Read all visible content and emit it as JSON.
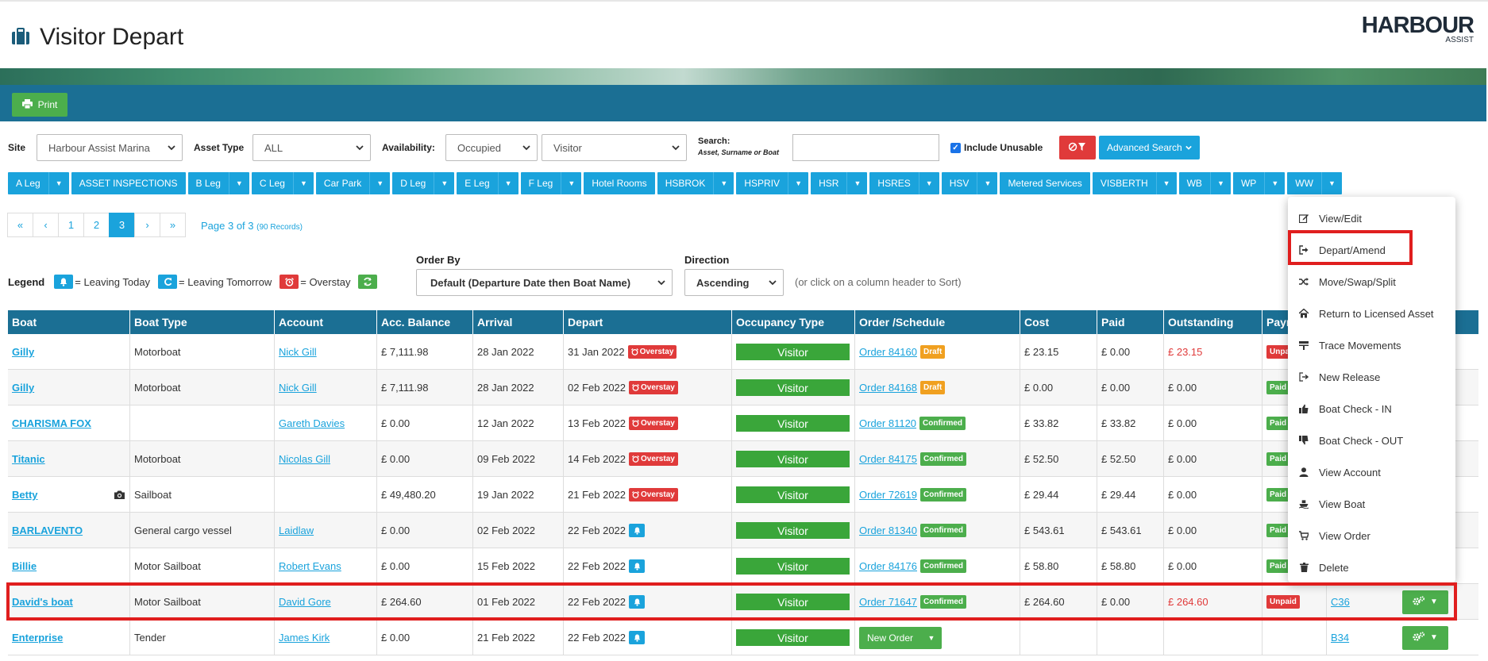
{
  "page": {
    "title": "Visitor Depart",
    "logo_main": "HARBOUR",
    "logo_sub": "ASSIST"
  },
  "toolbar": {
    "print_label": "Print"
  },
  "filters": {
    "site_label": "Site",
    "site_value": "Harbour Assist Marina",
    "asset_type_label": "Asset Type",
    "asset_type_value": "ALL",
    "availability_label": "Availability:",
    "availability_value": "Occupied",
    "availability_value2": "Visitor",
    "search_label": "Search:",
    "search_sub": "Asset, Surname or Boat",
    "search_value": "",
    "include_unusable_label": "Include Unusable",
    "include_unusable_checked": true,
    "advanced_search_label": "Advanced Search"
  },
  "leg_tabs": [
    {
      "label": "A Leg",
      "dropdown": true
    },
    {
      "label": "ASSET INSPECTIONS",
      "dropdown": false
    },
    {
      "label": "B Leg",
      "dropdown": true
    },
    {
      "label": "C Leg",
      "dropdown": true
    },
    {
      "label": "Car Park",
      "dropdown": true
    },
    {
      "label": "D Leg",
      "dropdown": true
    },
    {
      "label": "E Leg",
      "dropdown": true
    },
    {
      "label": "F Leg",
      "dropdown": true
    },
    {
      "label": "Hotel Rooms",
      "dropdown": false
    },
    {
      "label": "HSBROK",
      "dropdown": true
    },
    {
      "label": "HSPRIV",
      "dropdown": true
    },
    {
      "label": "HSR",
      "dropdown": true
    },
    {
      "label": "HSRES",
      "dropdown": true
    },
    {
      "label": "HSV",
      "dropdown": true
    },
    {
      "label": "Metered Services",
      "dropdown": false
    },
    {
      "label": "VISBERTH",
      "dropdown": true
    },
    {
      "label": "WB",
      "dropdown": true
    },
    {
      "label": "WP",
      "dropdown": true
    },
    {
      "label": "WW",
      "dropdown": true
    }
  ],
  "pagination": {
    "buttons": [
      "«",
      "‹",
      "1",
      "2",
      "3",
      "›",
      "»"
    ],
    "active": "3",
    "info": "Page 3 of 3",
    "records": "(90 Records)"
  },
  "legend": {
    "title": "Legend",
    "leaving_today": "= Leaving Today",
    "leaving_tomorrow": "= Leaving Tomorrow",
    "overstay": "= Overstay"
  },
  "order": {
    "order_by_label": "Order By",
    "order_by_value": "Default (Departure Date then Boat Name)",
    "direction_label": "Direction",
    "direction_value": "Ascending",
    "hint": "(or click on a column header to Sort)"
  },
  "table": {
    "columns": [
      "Boat",
      "Boat Type",
      "Account",
      "Acc. Balance",
      "Arrival",
      "Depart",
      "Occupancy Type",
      "Order /Schedule",
      "Cost",
      "Paid",
      "Outstanding",
      "Paym"
    ],
    "rows": [
      {
        "boat": "Gilly",
        "type": "Motorboat",
        "account": "Nick Gill",
        "balance": "£ 7,111.98",
        "arrival": "28 Jan 2022",
        "depart": "31 Jan 2022",
        "flag": "Overstay",
        "occupancy": "Visitor",
        "order": "Order 84160",
        "order_status": "Draft",
        "cost": "£ 23.15",
        "paid": "£ 0.00",
        "outstanding": "£ 23.15",
        "outstanding_red": true,
        "payment": "Unpaid",
        "asset": ""
      },
      {
        "boat": "Gilly",
        "type": "Motorboat",
        "account": "Nick Gill",
        "balance": "£ 7,111.98",
        "arrival": "28 Jan 2022",
        "depart": "02 Feb 2022",
        "flag": "Overstay",
        "occupancy": "Visitor",
        "order": "Order 84168",
        "order_status": "Draft",
        "cost": "£ 0.00",
        "paid": "£ 0.00",
        "outstanding": "£ 0.00",
        "outstanding_red": false,
        "payment": "Paid",
        "asset": ""
      },
      {
        "boat": "CHARISMA FOX",
        "type": "",
        "account": "Gareth Davies",
        "balance": "£ 0.00",
        "arrival": "12 Jan 2022",
        "depart": "13 Feb 2022",
        "flag": "Overstay",
        "occupancy": "Visitor",
        "order": "Order 81120",
        "order_status": "Confirmed",
        "cost": "£ 33.82",
        "paid": "£ 33.82",
        "outstanding": "£ 0.00",
        "outstanding_red": false,
        "payment": "Paid",
        "asset": ""
      },
      {
        "boat": "Titanic",
        "type": "Motorboat",
        "account": "Nicolas Gill",
        "balance": "£ 0.00",
        "arrival": "09 Feb 2022",
        "depart": "14 Feb 2022",
        "flag": "Overstay",
        "occupancy": "Visitor",
        "order": "Order 84175",
        "order_status": "Confirmed",
        "cost": "£ 52.50",
        "paid": "£ 52.50",
        "outstanding": "£ 0.00",
        "outstanding_red": false,
        "payment": "Paid",
        "asset": ""
      },
      {
        "boat": "Betty",
        "type": "Sailboat",
        "account": "",
        "balance": "£ 49,480.20",
        "arrival": "19 Jan 2022",
        "depart": "21 Feb 2022",
        "flag": "Overstay",
        "occupancy": "Visitor",
        "order": "Order 72619",
        "order_status": "Confirmed",
        "cost": "£ 29.44",
        "paid": "£ 29.44",
        "outstanding": "£ 0.00",
        "outstanding_red": false,
        "payment": "Paid",
        "asset": "",
        "camera": true
      },
      {
        "boat": "BARLAVENTO",
        "type": "General cargo vessel",
        "account": "Laidlaw",
        "balance": "£ 0.00",
        "arrival": "02 Feb 2022",
        "depart": "22 Feb 2022",
        "flag": "bell",
        "occupancy": "Visitor",
        "order": "Order 81340",
        "order_status": "Confirmed",
        "cost": "£ 543.61",
        "paid": "£ 543.61",
        "outstanding": "£ 0.00",
        "outstanding_red": false,
        "payment": "Paid",
        "asset": ""
      },
      {
        "boat": "Billie",
        "type": "Motor Sailboat",
        "account": "Robert Evans",
        "balance": "£ 0.00",
        "arrival": "15 Feb 2022",
        "depart": "22 Feb 2022",
        "flag": "bell",
        "occupancy": "Visitor",
        "order": "Order 84176",
        "order_status": "Confirmed",
        "cost": "£ 58.80",
        "paid": "£ 58.80",
        "outstanding": "£ 0.00",
        "outstanding_red": false,
        "payment": "Paid",
        "asset": ""
      },
      {
        "boat": "David's boat",
        "type": "Motor Sailboat",
        "account": "David Gore",
        "balance": "£ 264.60",
        "arrival": "01 Feb 2022",
        "depart": "22 Feb 2022",
        "flag": "bell",
        "occupancy": "Visitor",
        "order": "Order 71647",
        "order_status": "Confirmed",
        "cost": "£ 264.60",
        "paid": "£ 0.00",
        "outstanding": "£ 264.60",
        "outstanding_red": true,
        "payment": "Unpaid",
        "asset": "C36",
        "gear": true
      },
      {
        "boat": "Enterprise",
        "type": "Tender",
        "account": "James Kirk",
        "balance": "£ 0.00",
        "arrival": "21 Feb 2022",
        "depart": "22 Feb 2022",
        "flag": "bell",
        "occupancy": "Visitor",
        "order": "",
        "new_order": "New Order",
        "order_status": "",
        "cost": "",
        "paid": "",
        "outstanding": "",
        "outstanding_red": false,
        "payment": "",
        "asset": "B34",
        "gear": true
      }
    ]
  },
  "action_menu": {
    "items": [
      {
        "label": "View/Edit",
        "icon": "edit-icon"
      },
      {
        "label": "Depart/Amend",
        "icon": "sign-out-icon"
      },
      {
        "label": "Move/Swap/Split",
        "icon": "shuffle-icon"
      },
      {
        "label": "Return to Licensed Asset",
        "icon": "home-icon"
      },
      {
        "label": "Trace Movements",
        "icon": "trace-icon"
      },
      {
        "label": "New Release",
        "icon": "release-icon"
      },
      {
        "label": "Boat Check - IN",
        "icon": "thumbs-up-icon"
      },
      {
        "label": "Boat Check - OUT",
        "icon": "thumbs-down-icon"
      },
      {
        "label": "View Account",
        "icon": "user-icon"
      },
      {
        "label": "View Boat",
        "icon": "boat-icon"
      },
      {
        "label": "View Order",
        "icon": "cart-icon"
      },
      {
        "label": "Delete",
        "icon": "trash-icon"
      }
    ]
  },
  "colors": {
    "primary": "#1b6f94",
    "accent": "#1aa3dc",
    "success": "#4cae4c",
    "danger": "#e03a3a",
    "warning": "#f0a020"
  }
}
